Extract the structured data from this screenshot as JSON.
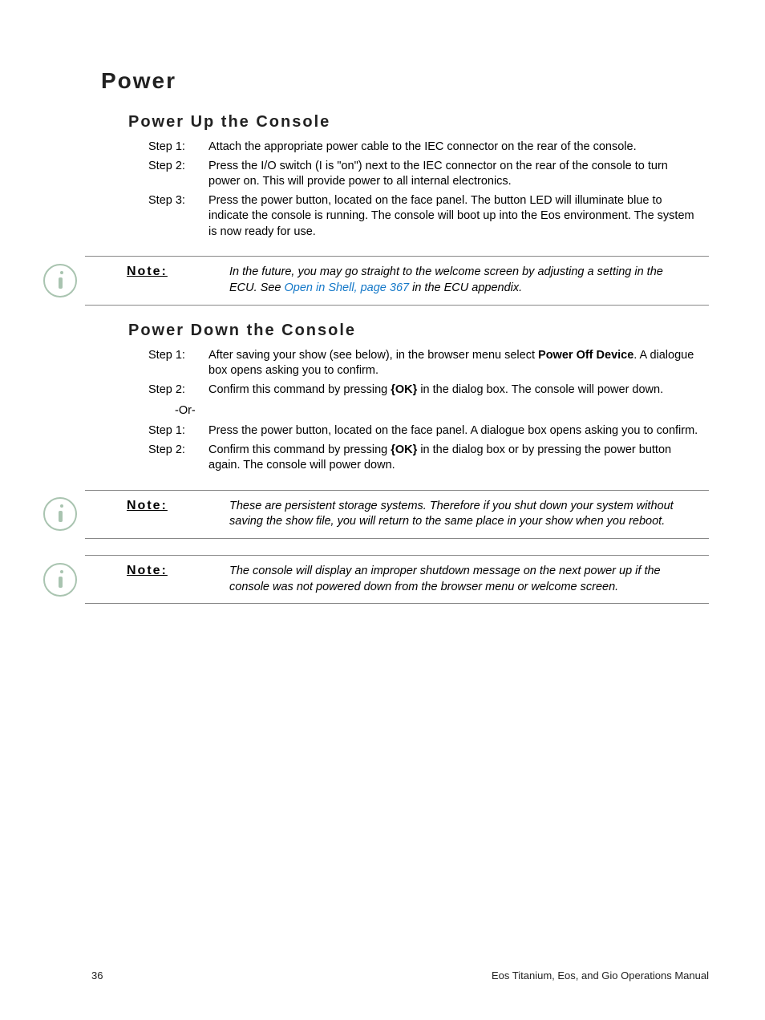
{
  "h1": "Power",
  "section1": {
    "title": "Power Up the Console",
    "steps": [
      {
        "label": "Step 1:",
        "text": "Attach the appropriate power cable to the IEC connector on the rear of the console."
      },
      {
        "label": "Step 2:",
        "text": "Press the I/O switch (I is \"on\") next to the IEC connector on the rear of the console to turn power on. This will provide power to all internal electronics."
      },
      {
        "label": "Step 3:",
        "text": "Press the power button, located on the face panel. The button LED will illuminate blue to indicate the console is running. The console will boot up into the Eos environment. The system is now ready for use."
      }
    ]
  },
  "note1": {
    "label": "Note:",
    "text_before": "In the future, you may go straight to the welcome screen by adjusting a setting in the ECU. See ",
    "link": "Open in Shell, page 367",
    "text_after": " in the ECU appendix."
  },
  "section2": {
    "title": "Power Down the Console",
    "steps_a": [
      {
        "label": "Step 1:",
        "text_before": "After saving your show (see below), in the browser menu select ",
        "bold": "Power Off Device",
        "text_after": ". A dialogue box opens asking you to confirm."
      },
      {
        "label": "Step 2:",
        "text_before": "Confirm this command by pressing ",
        "bold": "{OK}",
        "text_after": " in the dialog box. The console will power down."
      }
    ],
    "or": "-Or-",
    "steps_b": [
      {
        "label": "Step 1:",
        "text": "Press the power button, located on the face panel. A dialogue box opens asking you to confirm."
      },
      {
        "label": "Step 2:",
        "text_before": "Confirm this command by pressing ",
        "bold": "{OK}",
        "text_after": " in the dialog box or by pressing the power button again. The console will power down."
      }
    ]
  },
  "note2": {
    "label": "Note:",
    "text": "These are persistent storage systems. Therefore if you shut down your system without saving the show file, you will return to the same place in your show when you reboot."
  },
  "note3": {
    "label": "Note:",
    "text": "The console will display an improper shutdown message on the next power up if the console was not powered down from the browser menu or welcome screen."
  },
  "footer": {
    "page": "36",
    "title": "Eos Titanium, Eos, and Gio Operations Manual"
  }
}
